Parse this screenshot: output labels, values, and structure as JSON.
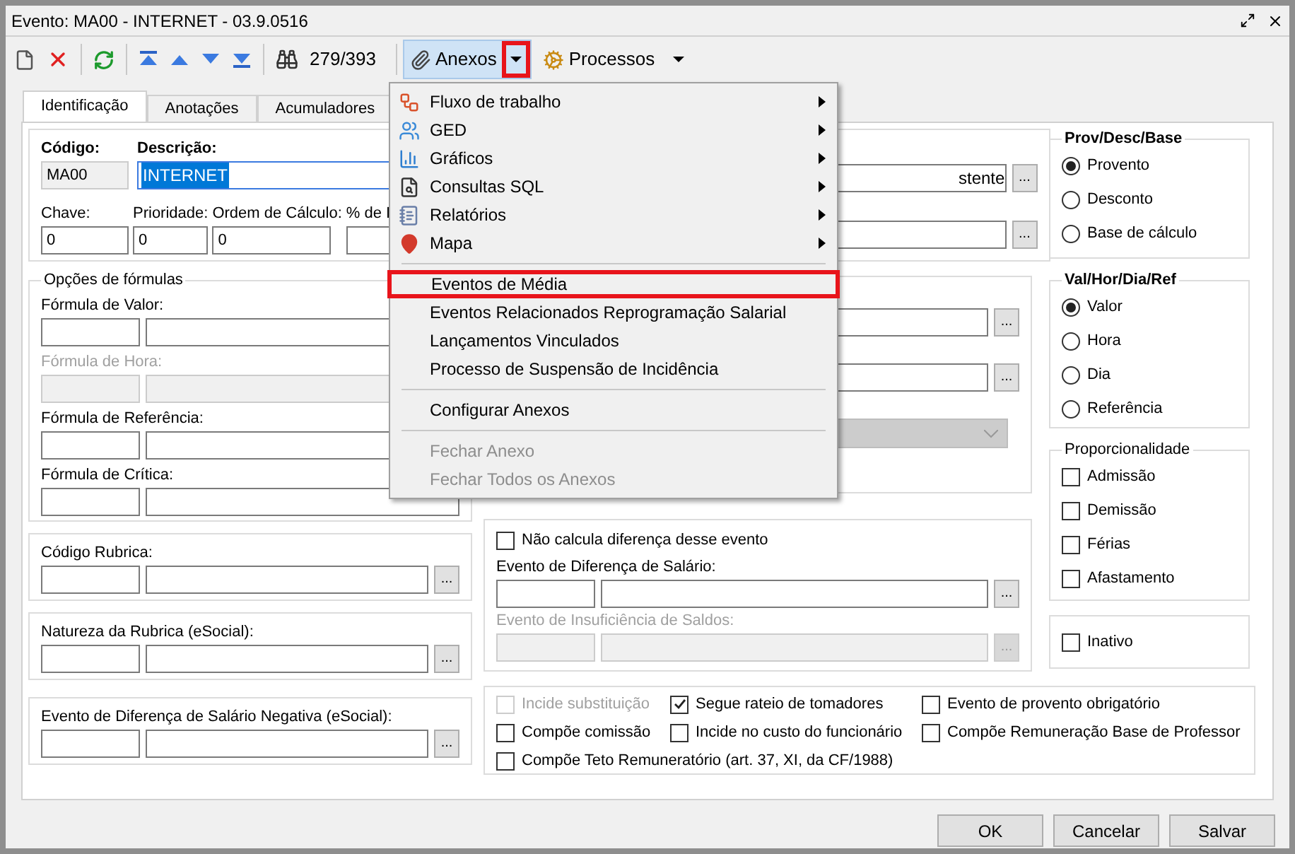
{
  "window": {
    "title": "Evento: MA00 - INTERNET - 03.9.0516"
  },
  "toolbar": {
    "record_counter": "279/393",
    "anexos": {
      "label": "Anexos",
      "arrow_highlighted": true
    },
    "processos": {
      "label": "Processos"
    }
  },
  "tabs": [
    {
      "label": "Identificação",
      "selected": true
    },
    {
      "label": "Anotações",
      "selected": false
    },
    {
      "label": "Acumuladores",
      "selected": false
    }
  ],
  "identification": {
    "code_label": "Código:",
    "code": "MA00",
    "description_label": "Descrição:",
    "description": "INTERNET",
    "fields": [
      {
        "label": "Chave:",
        "value": "0"
      },
      {
        "label": "Prioridade:",
        "value": "0"
      },
      {
        "label": "Ordem de Cálculo:",
        "value": "0"
      },
      {
        "label": "% de I"
      }
    ]
  },
  "formula_options": {
    "title": "Opções de fórmulas",
    "fields": [
      {
        "label": "Fórmula de Valor:",
        "disabled": false
      },
      {
        "label": "Fórmula de Hora:",
        "disabled": true
      },
      {
        "label": "Fórmula de Referência:",
        "disabled": false
      },
      {
        "label": "Fórmula de Crítica:",
        "disabled": false
      }
    ]
  },
  "left_lookups": [
    {
      "label": "Código Rubrica:",
      "button": "..."
    },
    {
      "label": "Natureza da Rubrica (eSocial):",
      "button": "..."
    },
    {
      "label": "Evento de Diferença de Salário Negativa (eSocial):",
      "button": "..."
    }
  ],
  "middle_upper": {
    "lookups": [
      {
        "value": "stente",
        "button": "..."
      },
      {
        "button": "..."
      }
    ]
  },
  "middle_second": {
    "lookups": [
      {
        "button": "..."
      },
      {
        "button": "..."
      }
    ]
  },
  "difference": {
    "checkbox": {
      "label": "Não calcula diferença desse evento",
      "checked": false
    },
    "lookups": [
      {
        "label": "Evento de Diferença de Salário:",
        "disabled": false,
        "button": "..."
      },
      {
        "label": "Evento de Insuficiência de Saldos:",
        "disabled": true,
        "button": "..."
      }
    ]
  },
  "flags": [
    {
      "label": "Incide substituição",
      "checked": false,
      "disabled": true
    },
    {
      "label": "Segue rateio de tomadores",
      "checked": true,
      "disabled": false
    },
    {
      "label": "Evento de provento obrigatório",
      "checked": false,
      "disabled": false
    },
    {
      "label": "Compõe comissão",
      "checked": false,
      "disabled": false
    },
    {
      "label": "Incide no custo do funcionário",
      "checked": false,
      "disabled": false
    },
    {
      "label": "Compõe Remuneração Base de Professor",
      "checked": false,
      "disabled": false
    },
    {
      "label": "Compõe Teto Remuneratório (art. 37, XI, da CF/1988)",
      "checked": false,
      "disabled": false
    }
  ],
  "prov_desc_base": {
    "title": "Prov/Desc/Base",
    "options": [
      {
        "label": "Provento",
        "selected": true
      },
      {
        "label": "Desconto",
        "selected": false
      },
      {
        "label": "Base de cálculo",
        "selected": false
      }
    ]
  },
  "val_hor_dia_ref": {
    "title": "Val/Hor/Dia/Ref",
    "options": [
      {
        "label": "Valor",
        "selected": true
      },
      {
        "label": "Hora",
        "selected": false
      },
      {
        "label": "Dia",
        "selected": false
      },
      {
        "label": "Referência",
        "selected": false
      }
    ]
  },
  "proporcionalidade": {
    "title": "Proporcionalidade",
    "options": [
      {
        "label": "Admissão",
        "checked": false
      },
      {
        "label": "Demissão",
        "checked": false
      },
      {
        "label": "Férias",
        "checked": false
      },
      {
        "label": "Afastamento",
        "checked": false
      }
    ]
  },
  "inativo": {
    "label": "Inativo",
    "checked": false
  },
  "buttons": [
    "OK",
    "Cancelar",
    "Salvar"
  ],
  "menu": {
    "items": [
      {
        "kind": "submenu",
        "label": "Fluxo de trabalho"
      },
      {
        "kind": "submenu",
        "label": "GED"
      },
      {
        "kind": "submenu",
        "label": "Gráficos"
      },
      {
        "kind": "submenu",
        "label": "Consultas SQL"
      },
      {
        "kind": "submenu",
        "label": "Relatórios"
      },
      {
        "kind": "submenu",
        "label": "Mapa"
      },
      {
        "kind": "separator"
      },
      {
        "kind": "item",
        "label": "Eventos de Média",
        "highlighted": true,
        "disabled": false
      },
      {
        "kind": "item",
        "label": "Eventos Relacionados Reprogramação Salarial",
        "highlighted": false,
        "disabled": false
      },
      {
        "kind": "item",
        "label": "Lançamentos Vinculados",
        "highlighted": false,
        "disabled": false
      },
      {
        "kind": "item",
        "label": "Processo de Suspensão de Incidência",
        "highlighted": false,
        "disabled": false
      },
      {
        "kind": "separator"
      },
      {
        "kind": "item",
        "label": "Configurar Anexos",
        "highlighted": false,
        "disabled": false
      },
      {
        "kind": "separator"
      },
      {
        "kind": "item",
        "label": "Fechar Anexo",
        "highlighted": false,
        "disabled": true
      },
      {
        "kind": "item",
        "label": "Fechar Todos os Anexos",
        "highlighted": false,
        "disabled": true
      }
    ]
  }
}
